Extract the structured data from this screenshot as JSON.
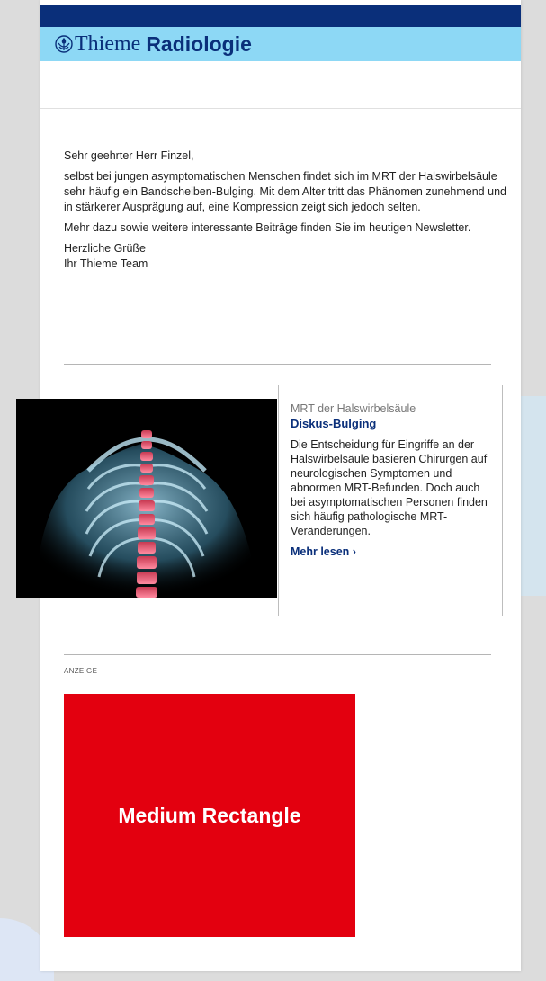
{
  "header": {
    "brand_part1": "Thieme",
    "brand_part2": "Radiologie",
    "colors": {
      "topbar": "#0a2f7a",
      "brandbar": "#8dd8f5"
    }
  },
  "intro": {
    "greeting": "Sehr geehrter Herr Finzel,",
    "paragraph1": "selbst bei jungen asymptomatischen Menschen findet sich im MRT der Halswirbelsäule sehr häufig ein Bandscheiben-Bulging. Mit dem Alter tritt das Phänomen zunehmend und in stärkerer Ausprägung auf, eine Kompression zeigt sich jedoch selten.",
    "paragraph2": "Mehr dazu sowie weitere interessante Beiträge finden Sie im heutigen Newsletter.",
    "closing_line1": "Herzliche Grüße",
    "closing_line2": "Ihr Thieme Team"
  },
  "article": {
    "image_icon": "spine-xray-image",
    "kicker": "MRT der Halswirbelsäule",
    "headline": "Diskus-Bulging",
    "teaser": "Die Entscheidung für Eingriffe an der Halswirbelsäule basieren Chirurgen auf neurologischen Symptomen und abnormen MRT-Befunden. Doch auch bei asymptomatischen Personen finden sich häufig pathologische MRT-Veränderungen.",
    "more_link": "Mehr lesen ›"
  },
  "ad": {
    "label": "ANZEIGE",
    "text": "Medium Rectangle",
    "color": "#e3000f"
  }
}
